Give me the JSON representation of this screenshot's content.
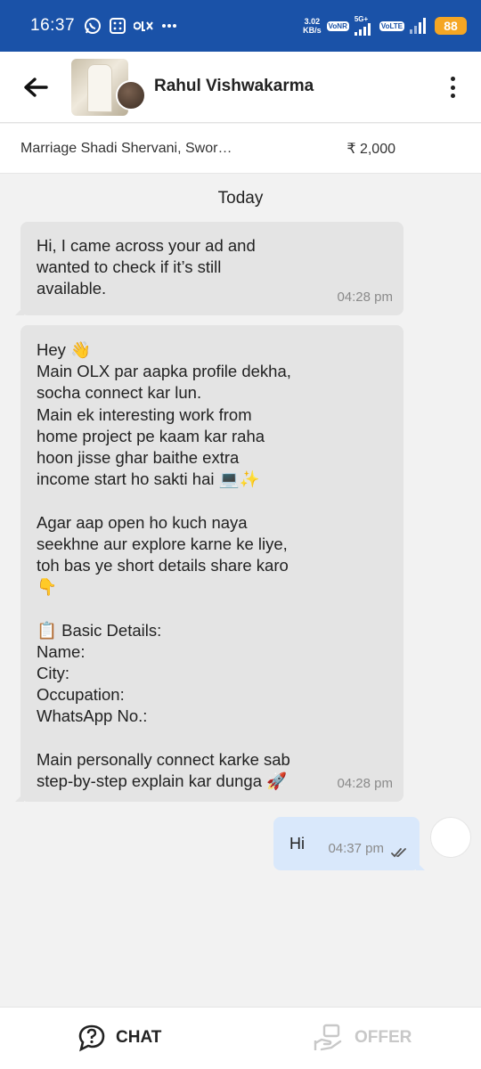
{
  "status_bar": {
    "time": "16:37",
    "speed_value": "3.02",
    "speed_unit": "KB/s",
    "net1": "VoNR",
    "net2_label": "5G+",
    "net3": "VoLTE",
    "battery": "88",
    "icons": [
      "whatsapp-icon",
      "calculator-icon",
      "olx-icon",
      "more-dots-icon",
      "signal-icon",
      "battery-icon"
    ]
  },
  "header": {
    "seller_name": "Rahul Vishwakarma"
  },
  "listing": {
    "title": "Marriage Shadi Shervani, Swor…",
    "price": "₹ 2,000"
  },
  "chat": {
    "day_label": "Today",
    "messages": [
      {
        "direction": "incoming",
        "text": "Hi, I came across your ad and\nwanted to check if it’s still\navailable.",
        "time": "04:28 pm"
      },
      {
        "direction": "incoming",
        "text": "Hey 👋\nMain OLX par aapka profile dekha,\nsocha connect kar lun.\nMain ek interesting work from\nhome project pe kaam kar raha\nhoon jisse ghar baithe extra\nincome start ho sakti hai 💻✨\n\nAgar aap open ho kuch naya\nseekhne aur explore karne ke liye,\ntoh bas ye short details share karo\n👇\n\n📋 Basic Details:\nName:\nCity:\nOccupation:\nWhatsApp No.:\n\nMain personally connect karke sab\nstep-by-step explain kar dunga 🚀",
        "time": "04:28 pm"
      },
      {
        "direction": "outgoing",
        "text": "Hi",
        "time": "04:37 pm",
        "status": "read"
      }
    ]
  },
  "bottom_bar": {
    "chat_label": "CHAT",
    "offer_label": "OFFER"
  },
  "colors": {
    "status_bar": "#1a52a8",
    "battery": "#f5a623",
    "incoming_bubble": "#e4e4e4",
    "outgoing_bubble": "#d9e8fb"
  }
}
